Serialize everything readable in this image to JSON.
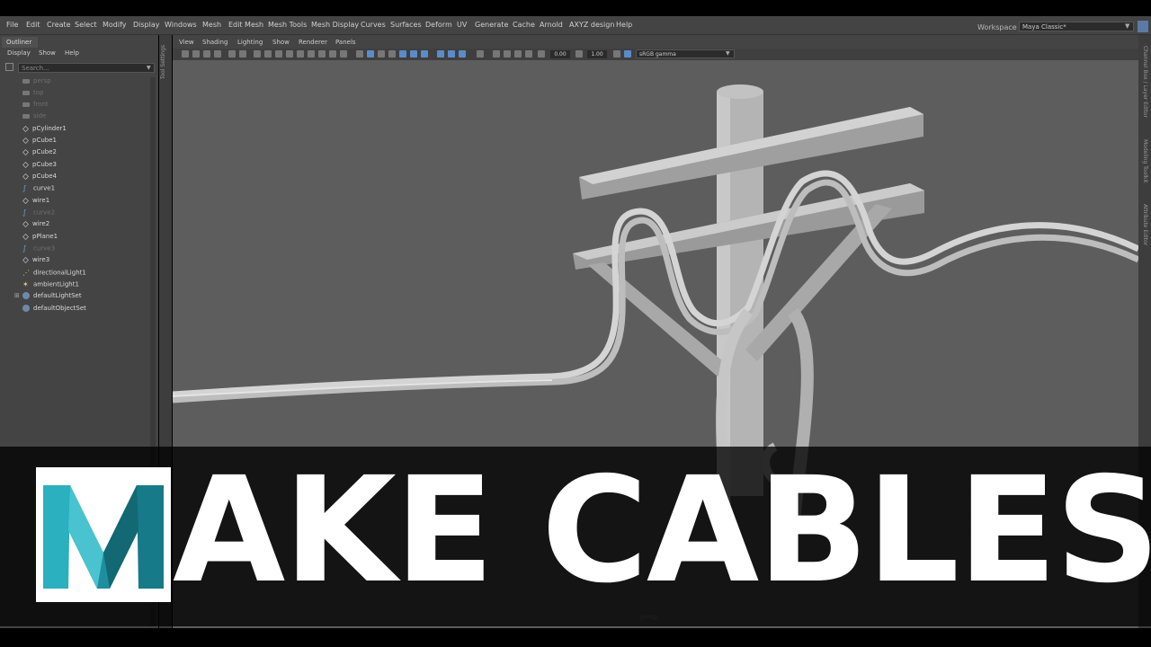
{
  "menubar": {
    "items": [
      "File",
      "Edit",
      "Create",
      "Select",
      "Modify",
      "Display",
      "Windows",
      "Mesh",
      "Edit Mesh",
      "Mesh Tools",
      "Mesh Display",
      "Curves",
      "Surfaces",
      "Deform",
      "UV",
      "Generate",
      "Cache",
      "Arnold",
      "AXYZ design",
      "Help"
    ],
    "workspace_label": "Workspace :",
    "workspace_value": "Maya Classic*"
  },
  "outliner": {
    "tab": "Outliner",
    "menu": [
      "Display",
      "Show",
      "Help"
    ],
    "search_placeholder": "Search...",
    "items": [
      {
        "label": "persp",
        "icon": "camera-icon",
        "dim": true
      },
      {
        "label": "top",
        "icon": "camera-icon",
        "dim": true
      },
      {
        "label": "front",
        "icon": "camera-icon",
        "dim": true
      },
      {
        "label": "side",
        "icon": "camera-icon",
        "dim": true
      },
      {
        "label": "pCylinder1",
        "icon": "mesh-icon",
        "dim": false
      },
      {
        "label": "pCube1",
        "icon": "mesh-icon",
        "dim": false
      },
      {
        "label": "pCube2",
        "icon": "mesh-icon",
        "dim": false
      },
      {
        "label": "pCube3",
        "icon": "mesh-icon",
        "dim": false
      },
      {
        "label": "pCube4",
        "icon": "mesh-icon",
        "dim": false
      },
      {
        "label": "curve1",
        "icon": "curve-icon",
        "dim": false
      },
      {
        "label": "wire1",
        "icon": "mesh-icon",
        "dim": false
      },
      {
        "label": "curve2",
        "icon": "curve-icon",
        "dim": true
      },
      {
        "label": "wire2",
        "icon": "mesh-icon",
        "dim": false
      },
      {
        "label": "pPlane1",
        "icon": "mesh-icon",
        "dim": false
      },
      {
        "label": "curve3",
        "icon": "curve-icon",
        "dim": true
      },
      {
        "label": "wire3",
        "icon": "mesh-icon",
        "dim": false
      },
      {
        "label": "directionalLight1",
        "icon": "directional-light-icon",
        "dim": false
      },
      {
        "label": "ambientLight1",
        "icon": "ambient-light-icon",
        "dim": false
      },
      {
        "label": "defaultLightSet",
        "icon": "set-icon",
        "dim": false
      },
      {
        "label": "defaultObjectSet",
        "icon": "set-icon",
        "dim": false
      }
    ]
  },
  "side_strip": {
    "label": "Tool Settings"
  },
  "viewport": {
    "menu": [
      "View",
      "Shading",
      "Lighting",
      "Show",
      "Renderer",
      "Panels"
    ],
    "field_a": "0.00",
    "field_b": "1.00",
    "color_space": "sRGB gamma",
    "camera_label": "persp"
  },
  "right_strip": {
    "labels": [
      "Channel Box / Layer Editor",
      "Modeling Toolkit",
      "Attribute Editor"
    ]
  },
  "banner": {
    "title": "AKE CABLES",
    "logo_letter": "M"
  },
  "colors": {
    "background": "#5d5d5d",
    "panel": "#444444",
    "logo_teal": "#1f8f9e",
    "banner_text": "#ffffff"
  }
}
